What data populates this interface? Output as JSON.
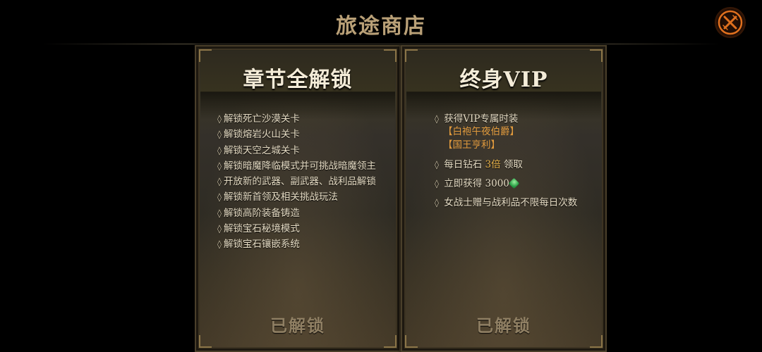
{
  "header": {
    "title": "旅途商店"
  },
  "close_icon": "close-x-icon",
  "left_panel": {
    "title": "章节全解锁",
    "items": [
      "解锁死亡沙漠关卡",
      "解锁熔岩火山关卡",
      "解锁天空之城关卡",
      "解锁暗魔降临模式并可挑战暗魔领主",
      "开放新的武器、副武器、战利品解锁",
      "解锁新首领及相关挑战玩法",
      "解锁高阶装备铸造",
      "解锁宝石秘境模式",
      "解锁宝石镶嵌系统"
    ],
    "status": "已解锁"
  },
  "right_panel": {
    "title": "终身VIP",
    "item1": "获得VIP专属时装",
    "item1_sub1": "【白袍午夜伯爵】",
    "item1_sub2": "【国王亨利】",
    "item2_pre": "每日钻石",
    "item2_highlight": "3倍",
    "item2_post": "领取",
    "item3_pre": "立即获得",
    "item3_value": "3000",
    "item4": "女战士赠与战利品不限每日次数",
    "status": "已解锁"
  },
  "colors": {
    "title": "#b9a077",
    "accent": "#e19a3d",
    "close_glow": "#e06a1a"
  }
}
